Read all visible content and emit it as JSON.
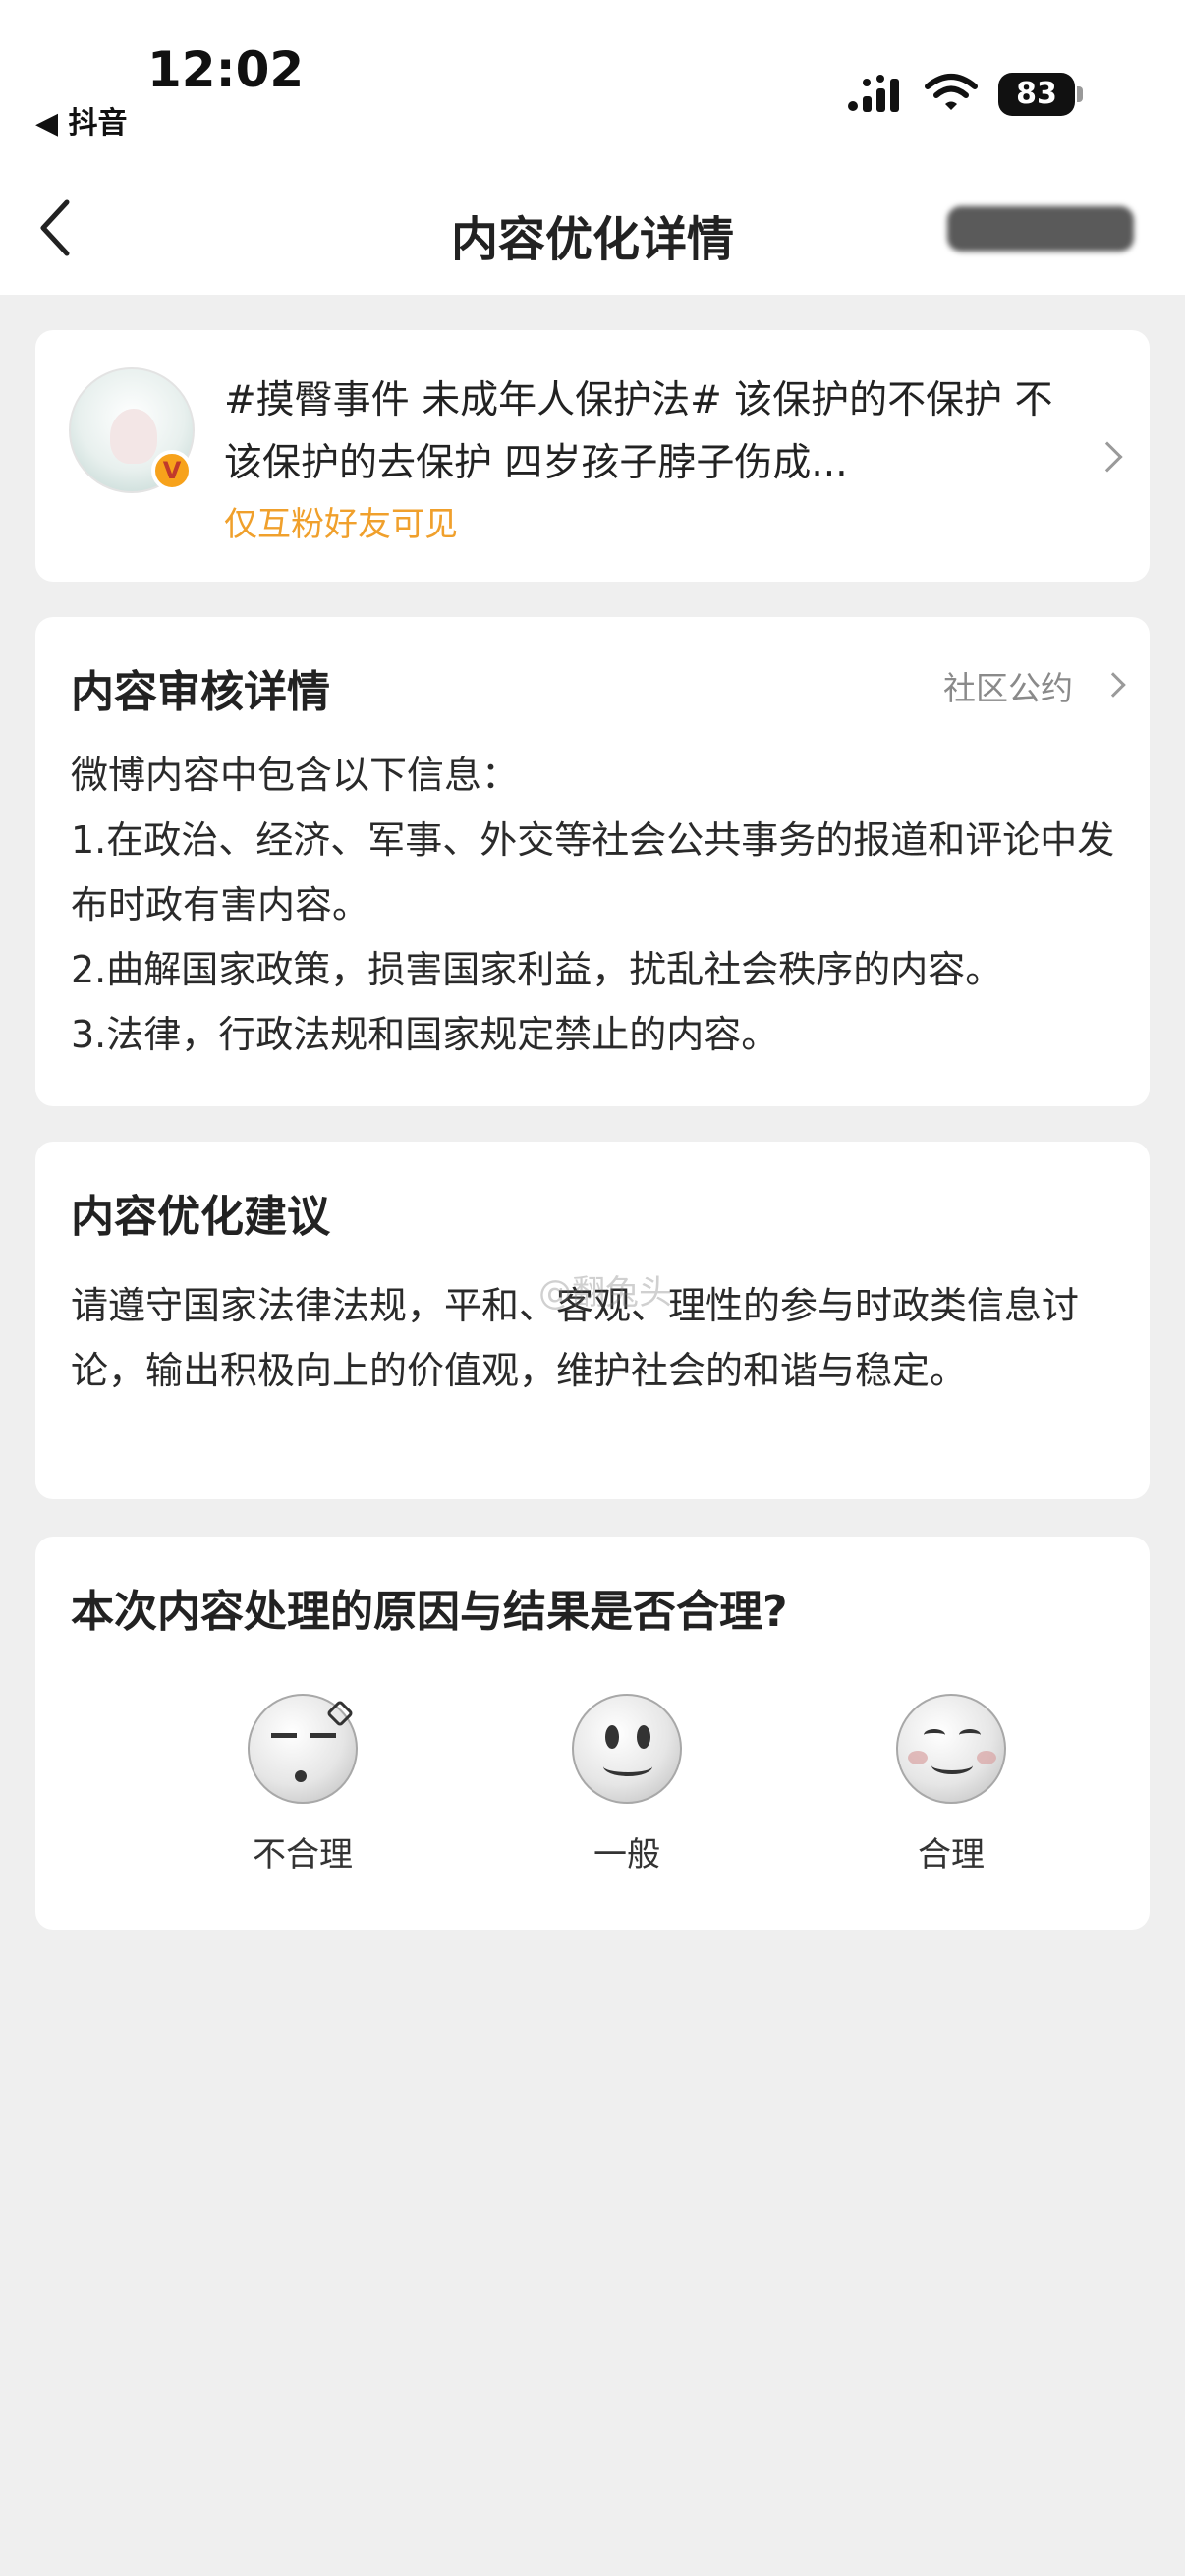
{
  "status_bar": {
    "time": "12:02",
    "back_app": "◀ 抖音",
    "battery": "83"
  },
  "nav": {
    "title": "内容优化详情"
  },
  "post": {
    "text": "#摸臀事件 未成年人保护法# 该保护的不保护 不该保护的去保护 四岁孩子脖子伤成...",
    "visibility": "仅互粉好友可见",
    "badge": "V"
  },
  "review": {
    "title": "内容审核详情",
    "link": "社区公约",
    "lines": [
      "微博内容中包含以下信息：",
      "1.在政治、经济、军事、外交等社会公共事务的报道和评论中发布时政有害内容。",
      "2.曲解国家政策，损害国家利益，扰乱社会秩序的内容。",
      "3.法律，行政法规和国家规定禁止的内容。"
    ]
  },
  "suggestion": {
    "title": "内容优化建议",
    "body": "请遵守国家法律法规，平和、客观、理性的参与时政类信息讨论，输出积极向上的价值观，维护社会的和谐与稳定。",
    "watermark": "@翻兔头"
  },
  "feedback": {
    "question": "本次内容处理的原因与结果是否合理?",
    "options": [
      {
        "label": "不合理",
        "icon": "annoyed-face-icon"
      },
      {
        "label": "一般",
        "icon": "neutral-face-icon"
      },
      {
        "label": "合理",
        "icon": "smiling-face-icon"
      }
    ]
  }
}
